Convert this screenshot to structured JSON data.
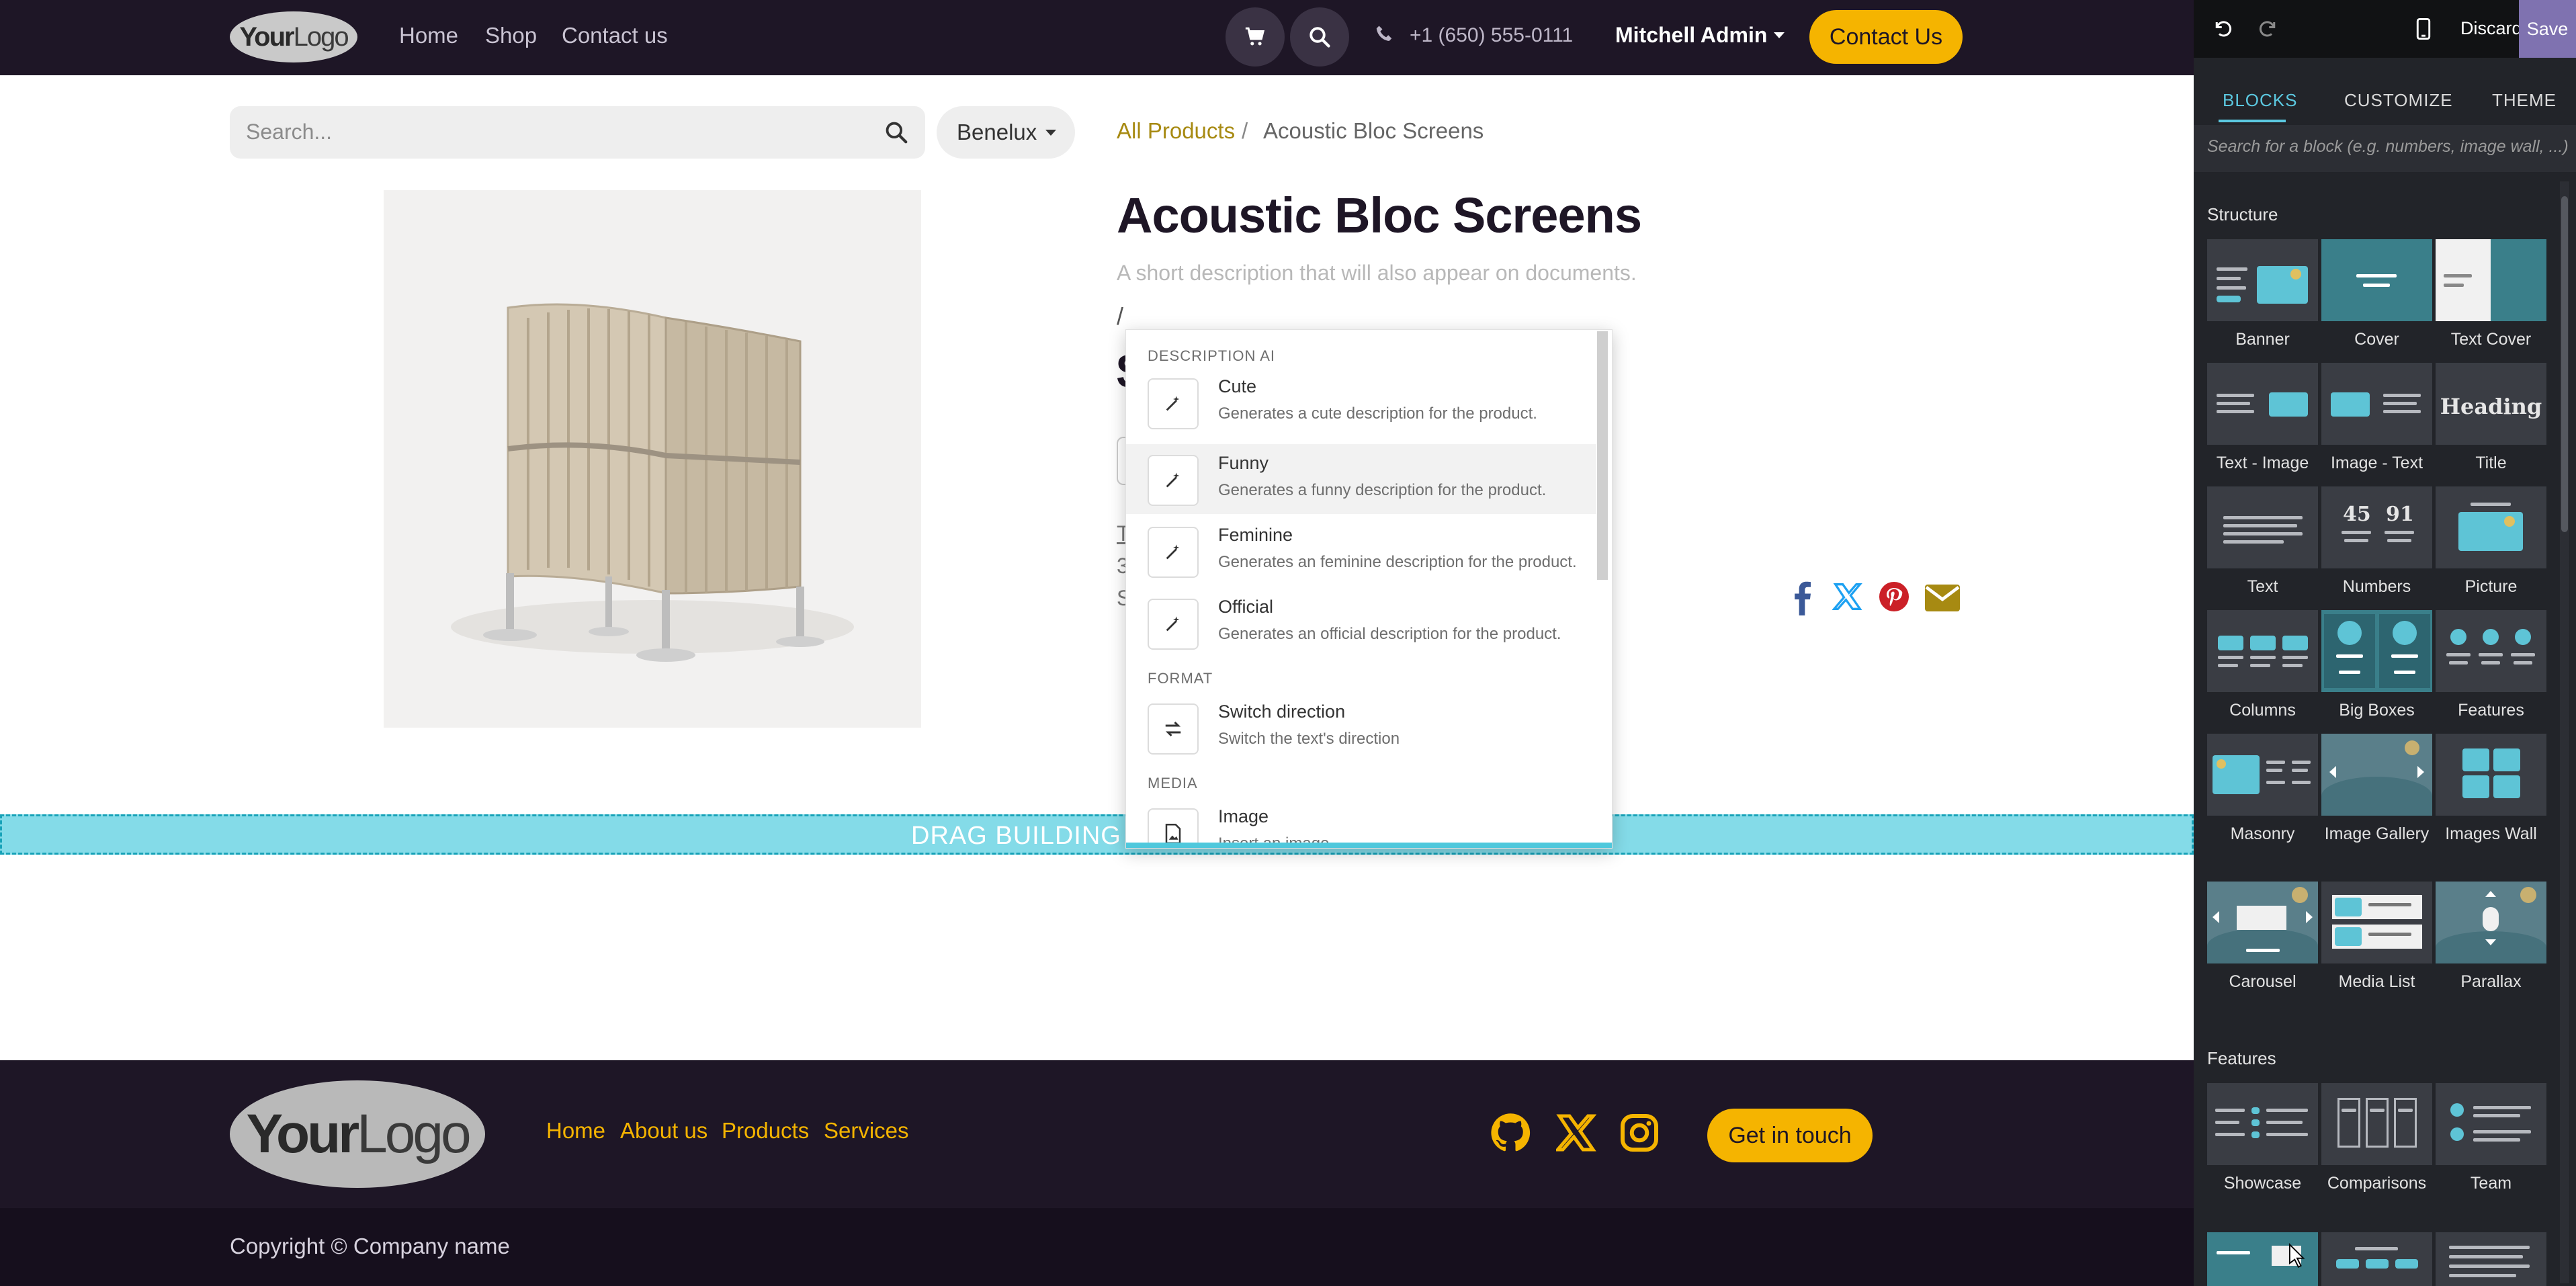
{
  "header": {
    "logo_text_bold": "Your",
    "logo_text_light": "Logo",
    "nav": [
      "Home",
      "Shop",
      "Contact us"
    ],
    "cart_icon": "cart-icon",
    "search_icon": "search-icon",
    "phone": "+1 (650) 555-0111",
    "user": "Mitchell Admin",
    "contact_button": "Contact Us"
  },
  "shop": {
    "search_placeholder": "Search...",
    "pricelist": "Benelux",
    "breadcrumb_root": "All Products",
    "breadcrumb_sep": "/",
    "breadcrumb_current": "Acoustic Bloc Screens"
  },
  "product": {
    "title": "Acoustic Bloc Screens",
    "short_description_placeholder": "A short description that will also appear on documents.",
    "typed_text": "/",
    "hidden_price": "$",
    "hidden_lines": [
      "T",
      "3",
      "S"
    ],
    "share_icons": [
      "facebook-icon",
      "x-icon",
      "pinterest-icon",
      "email-icon"
    ]
  },
  "dropdown": {
    "sections": [
      {
        "title": "DESCRIPTION AI",
        "items": [
          {
            "name": "Cute",
            "desc": "Generates a cute description for the product."
          },
          {
            "name": "Funny",
            "desc": "Generates a funny description for the product."
          },
          {
            "name": "Feminine",
            "desc": "Generates an feminine description for the product."
          },
          {
            "name": "Official",
            "desc": "Generates an official description for the product."
          }
        ]
      },
      {
        "title": "FORMAT",
        "items": [
          {
            "name": "Switch direction",
            "desc": "Switch the text's direction"
          }
        ]
      },
      {
        "title": "MEDIA",
        "items": [
          {
            "name": "Image",
            "desc": "Insert an image"
          }
        ]
      }
    ],
    "active_item": "Funny"
  },
  "dropzone": {
    "text": "DRAG BUILDING B"
  },
  "footer": {
    "logo_text_bold": "Your",
    "logo_text_light": "Logo",
    "links": [
      "Home",
      "About us",
      "Products",
      "Services"
    ],
    "social_icons": [
      "github-icon",
      "x-icon",
      "instagram-icon"
    ],
    "cta": "Get in touch",
    "copyright": "Copyright © Company name"
  },
  "editor": {
    "undo_icon": "undo-icon",
    "redo_icon": "redo-icon",
    "mobile_icon": "mobile-preview-icon",
    "discard": "Discard",
    "save": "Save",
    "tabs": [
      "BLOCKS",
      "CUSTOMIZE",
      "THEME"
    ],
    "active_tab": "BLOCKS",
    "search_placeholder": "Search for a block (e.g. numbers, image wall, ...)",
    "structure_title": "Structure",
    "structure_blocks": [
      "Banner",
      "Cover",
      "Text Cover",
      "Text - Image",
      "Image - Text",
      "Title",
      "Text",
      "Numbers",
      "Picture",
      "Columns",
      "Big Boxes",
      "Features",
      "Masonry",
      "Image Gallery",
      "Images Wall",
      "Carousel",
      "Media List",
      "Parallax"
    ],
    "features_title": "Features",
    "feature_blocks": [
      "Showcase",
      "Comparisons",
      "Team"
    ],
    "title_block_heading": "Heading",
    "numbers_digits": [
      "45",
      "91"
    ]
  },
  "colors": {
    "header_bg": "#1e1626",
    "accent": "#f5b400",
    "link_gold": "#a78a12",
    "panel_bg": "#222429",
    "panel_accent": "#5bc8e0",
    "save_bg": "#7f72b0",
    "dropzone": "#84dbe8"
  }
}
